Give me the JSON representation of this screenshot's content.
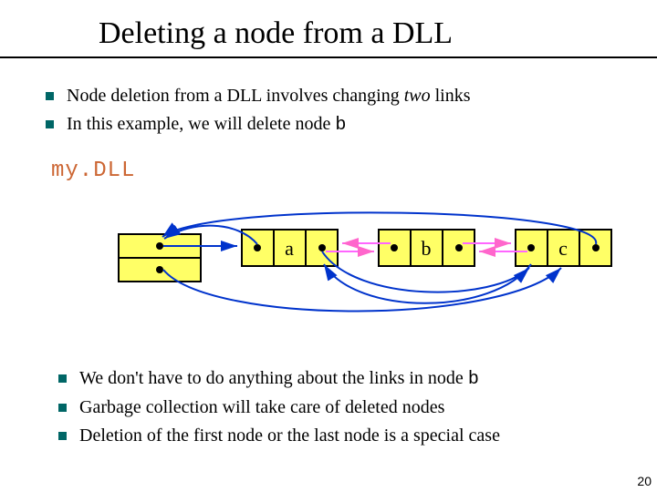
{
  "title": "Deleting a node from a DLL",
  "bullets_top": [
    {
      "pre": "Node deletion from a DLL involves changing ",
      "em": "two",
      "post": " links"
    },
    {
      "pre": "In this example, we will delete node ",
      "code": "b",
      "post": ""
    }
  ],
  "mydll_label": "my.DLL",
  "nodes": {
    "a": "a",
    "b": "b",
    "c": "c"
  },
  "bullets_bottom": [
    {
      "pre": "We don't have to do anything about the links in node ",
      "code": "b"
    },
    {
      "pre": "Garbage collection will take care of deleted nodes"
    },
    {
      "pre": "Deletion of the first node or the last node is a special case"
    }
  ],
  "page_number": "20",
  "colors": {
    "bullet": "#006666",
    "node_yellow": "#ffff66",
    "arrow_blue": "#0033cc",
    "arrow_pink": "#ff66cc",
    "deleted_pink": "#ff66ff",
    "mono_orange": "#cc6633"
  }
}
